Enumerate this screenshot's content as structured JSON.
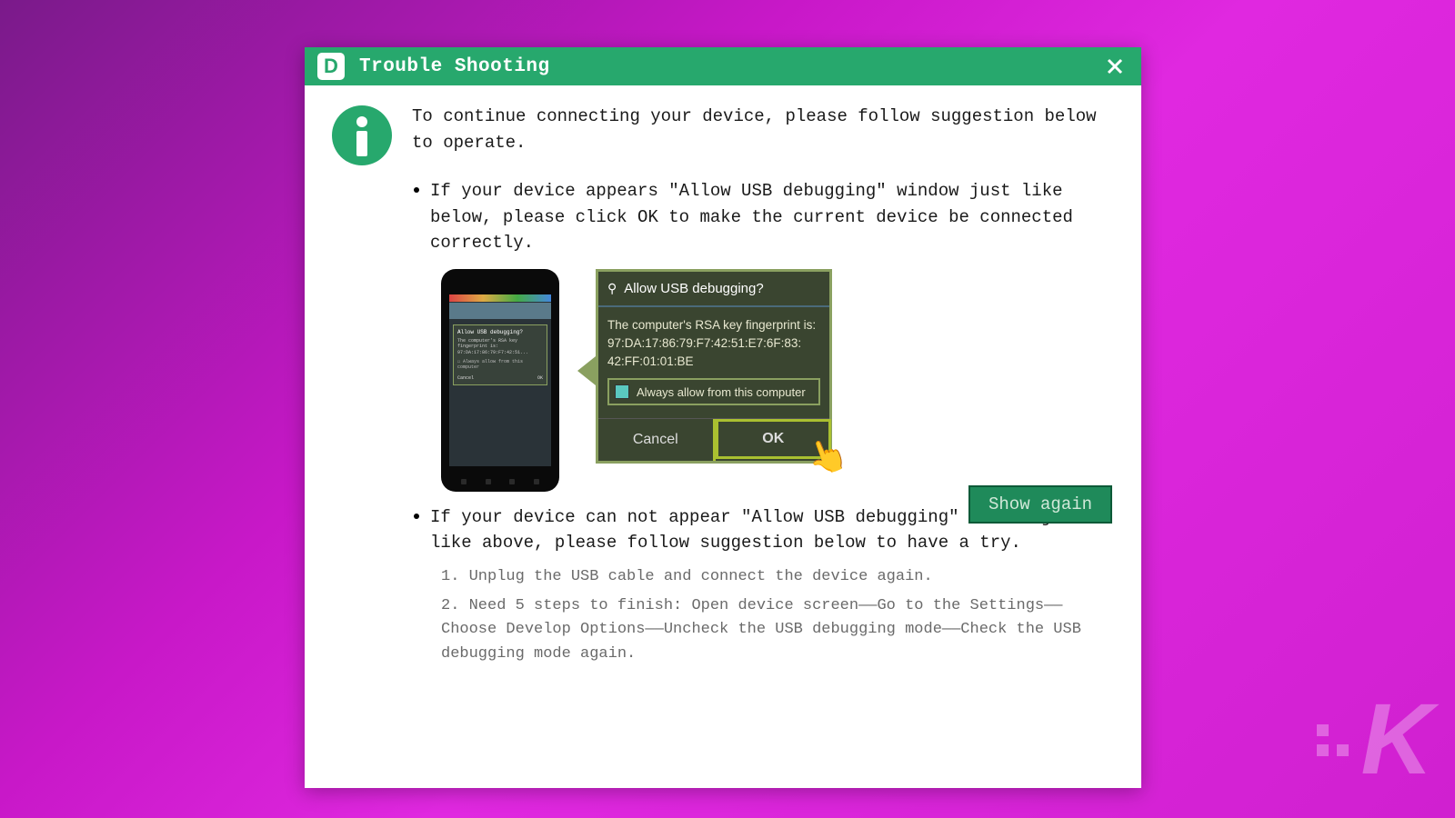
{
  "titlebar": {
    "app_letter": "D",
    "title": "Trouble Shooting"
  },
  "intro": "To continue connecting your device, please follow suggestion below to operate.",
  "bullet1": "If your device appears \"Allow USB debugging\" window just like below, please click OK to make the current device  be connected correctly.",
  "bullet2": "If your device can not appear \"Allow USB debugging\" window just like above, please follow suggestion below to have a try.",
  "usb_dialog": {
    "title": "Allow USB debugging?",
    "body_line1": "The computer's RSA key fingerprint is:",
    "body_line2": "97:DA:17:86:79:F7:42:51:E7:6F:83:",
    "body_line3": "42:FF:01:01:BE",
    "checkbox_label": "Always allow from this computer",
    "cancel": "Cancel",
    "ok": "OK"
  },
  "show_again": "Show again",
  "step1": "1. Unplug the USB cable and connect the device again.",
  "step2": "2. Need 5 steps to finish: Open device screen——Go to the Settings——Choose Develop Options——Uncheck the USB debugging mode——Check the USB debugging mode again.",
  "watermark": "K"
}
